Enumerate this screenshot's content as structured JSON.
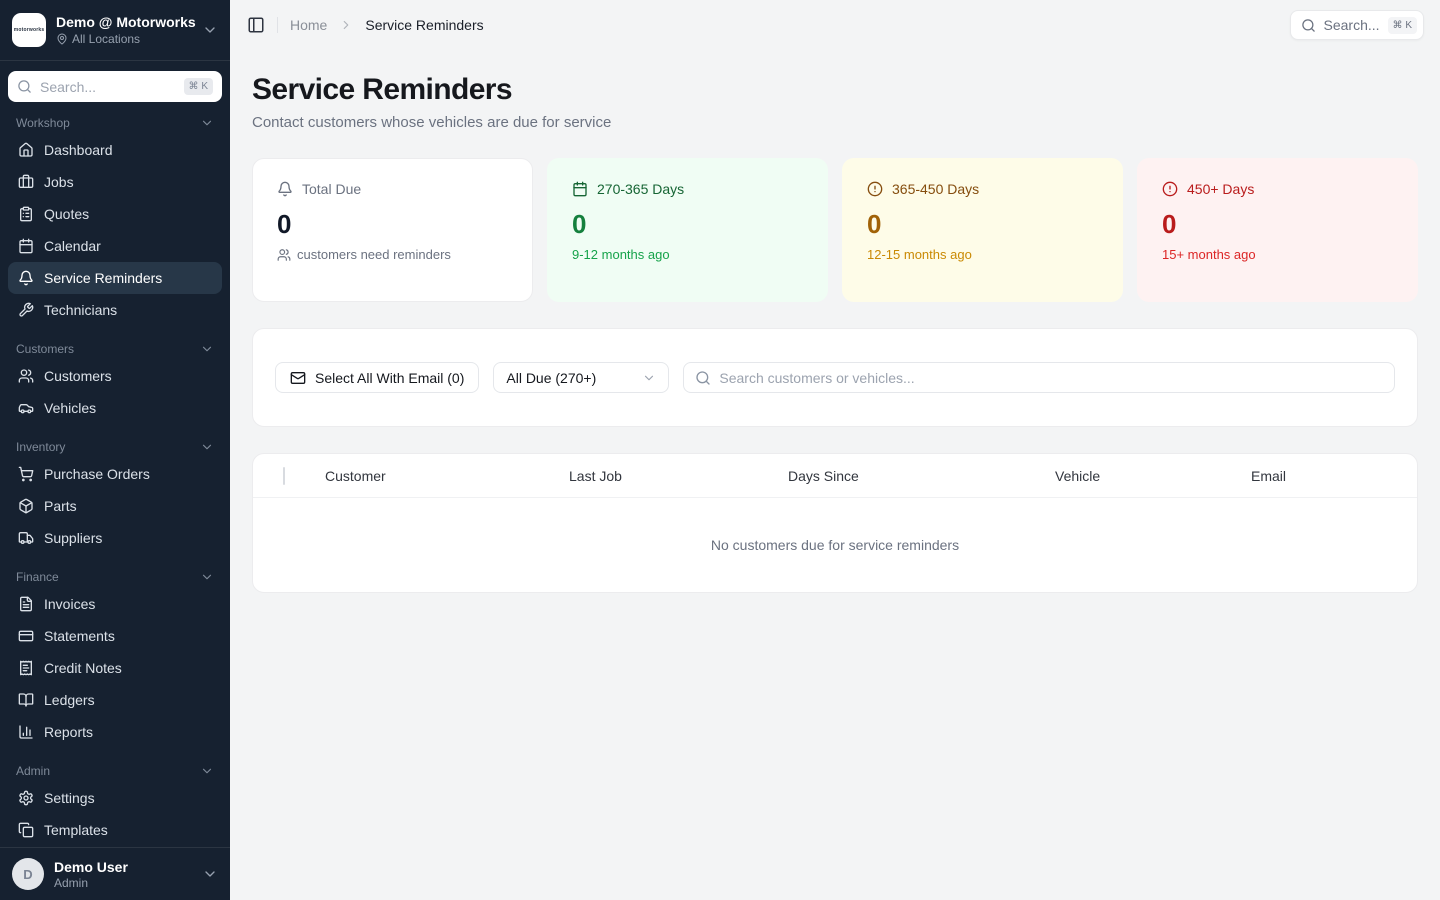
{
  "sidebar": {
    "org": {
      "logo_text": "motorworks",
      "name": "Demo @ Motorworks",
      "location": "All Locations"
    },
    "search": {
      "placeholder": "Search...",
      "shortcut": "⌘ K"
    },
    "sections": [
      {
        "label": "Workshop",
        "items": [
          {
            "label": "Dashboard"
          },
          {
            "label": "Jobs"
          },
          {
            "label": "Quotes"
          },
          {
            "label": "Calendar"
          },
          {
            "label": "Service Reminders",
            "active": true
          },
          {
            "label": "Technicians"
          }
        ]
      },
      {
        "label": "Customers",
        "items": [
          {
            "label": "Customers"
          },
          {
            "label": "Vehicles"
          }
        ]
      },
      {
        "label": "Inventory",
        "items": [
          {
            "label": "Purchase Orders"
          },
          {
            "label": "Parts"
          },
          {
            "label": "Suppliers"
          }
        ]
      },
      {
        "label": "Finance",
        "items": [
          {
            "label": "Invoices"
          },
          {
            "label": "Statements"
          },
          {
            "label": "Credit Notes"
          },
          {
            "label": "Ledgers"
          },
          {
            "label": "Reports"
          }
        ]
      },
      {
        "label": "Admin",
        "items": [
          {
            "label": "Settings"
          },
          {
            "label": "Templates"
          }
        ]
      }
    ],
    "user": {
      "initial": "D",
      "name": "Demo User",
      "role": "Admin"
    }
  },
  "topbar": {
    "breadcrumb": {
      "home": "Home",
      "current": "Service Reminders"
    },
    "search": {
      "label": "Search...",
      "shortcut": "⌘ K"
    }
  },
  "page": {
    "title": "Service Reminders",
    "subtitle": "Contact customers whose vehicles are due for service"
  },
  "stats": {
    "cards": [
      {
        "title": "Total Due",
        "value": "0",
        "subtitle": "customers need reminders",
        "variant": "neutral"
      },
      {
        "title": "270-365 Days",
        "value": "0",
        "subtitle": "9-12 months ago",
        "variant": "green"
      },
      {
        "title": "365-450 Days",
        "value": "0",
        "subtitle": "12-15 months ago",
        "variant": "yellow"
      },
      {
        "title": "450+ Days",
        "value": "0",
        "subtitle": "15+ months ago",
        "variant": "red"
      }
    ]
  },
  "filters": {
    "select_all_label": "Select All With Email (0)",
    "range_value": "All Due (270+)",
    "search_placeholder": "Search customers or vehicles..."
  },
  "table": {
    "columns": [
      "Customer",
      "Last Job",
      "Days Since",
      "Vehicle",
      "Email"
    ],
    "empty_message": "No customers due for service reminders"
  },
  "colors": {
    "sidebar_bg": "#162130",
    "sidebar_active_bg": "#273748",
    "green_bg": "#f0fdf4",
    "green_text": "#15803d",
    "yellow_bg": "#fefce8",
    "yellow_text": "#a16207",
    "red_bg": "#fef2f2",
    "red_text": "#b91c1c"
  }
}
